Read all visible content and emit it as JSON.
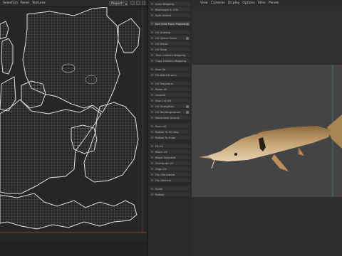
{
  "uv_editor": {
    "menu": [
      "Selection",
      "Panel",
      "Textures"
    ],
    "view_dropdown": "Project"
  },
  "uv_tools": {
    "items": [
      {
        "label": "Auto Mapping"
      },
      {
        "label": "Rectangle in UVs"
      },
      {
        "label": "Split Unfold"
      },
      {
        "label": "Set UVW From Projection",
        "active": true,
        "badge": true
      },
      {
        "label": "UV Unwrap"
      },
      {
        "label": "UV Select Faces",
        "badge": true
      },
      {
        "label": "UV Mirror"
      },
      {
        "label": "UV Snap"
      },
      {
        "label": "Tiles Uniform Mapping"
      },
      {
        "label": "Copy Uniform Mapping"
      },
      {
        "label": "Sew UV"
      },
      {
        "label": "Fix Weld Seams"
      },
      {
        "label": "UV Transform"
      },
      {
        "label": "Relax All"
      },
      {
        "label": "Unweld"
      },
      {
        "label": "Sew Cut UV"
      },
      {
        "label": "UV Straighten",
        "badge": true
      },
      {
        "label": "UV Rectangularize",
        "badge": true
      },
      {
        "label": "Normalize Islands"
      },
      {
        "label": "Pack UV"
      },
      {
        "label": "Rotate To 90 Deg"
      },
      {
        "label": "Rotate To Edge"
      },
      {
        "label": "Fit UV"
      },
      {
        "label": "Stack UV"
      },
      {
        "label": "Stack Selected"
      },
      {
        "label": "Distribute UV"
      },
      {
        "label": "Align UV"
      },
      {
        "label": "Flip Horizontal"
      },
      {
        "label": "Flip Vertical"
      },
      {
        "label": "Scale"
      },
      {
        "label": "Rotate"
      }
    ]
  },
  "viewport": {
    "menu": [
      "View",
      "Cameras",
      "Display",
      "Options",
      "Filter",
      "Panels"
    ]
  },
  "colors": {
    "uv_background": "#262626",
    "uv_wire": "#d8d8d8",
    "viewport_background": "#444444",
    "model_body": "#b8955c",
    "boundary_red": "#b5404a"
  }
}
